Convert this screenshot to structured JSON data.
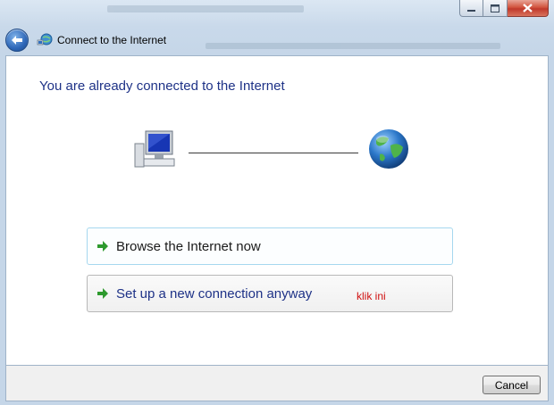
{
  "window": {
    "title": "Connect to the Internet",
    "caption_buttons": [
      "minimize",
      "maximize",
      "close"
    ]
  },
  "icons": {
    "back": "back-arrow-icon",
    "network": "network-icon",
    "computer": "computer-icon",
    "globe": "globe-icon",
    "option_arrow": "green-arrow-icon"
  },
  "main": {
    "heading": "You are already connected to the Internet",
    "options": [
      {
        "label": "Browse the Internet now"
      },
      {
        "label": "Set up a new connection anyway"
      }
    ],
    "annotation": "klik ini"
  },
  "footer": {
    "cancel_label": "Cancel"
  },
  "colors": {
    "heading": "#1e3287",
    "annotation": "#d01010",
    "arrow": "#2e9a2e",
    "close_button": "#c0392b"
  }
}
